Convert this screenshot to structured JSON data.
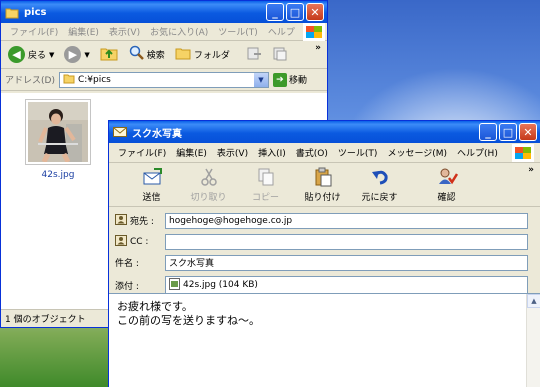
{
  "explorer": {
    "title": "pics",
    "menu": [
      "ファイル(F)",
      "編集(E)",
      "表示(V)",
      "お気に入り(A)",
      "ツール(T)",
      "ヘルプ"
    ],
    "toolbar": {
      "back": "戻る",
      "search": "検索",
      "folders": "フォルダ"
    },
    "address_label": "アドレス(D)",
    "address_value": "C:¥pics",
    "go_label": "移動",
    "file": {
      "name": "42s.jpg"
    },
    "status": "1 個のオブジェクト"
  },
  "mail": {
    "title": "スク水写真",
    "menu": [
      "ファイル(F)",
      "編集(E)",
      "表示(V)",
      "挿入(I)",
      "書式(O)",
      "ツール(T)",
      "メッセージ(M)",
      "ヘルプ(H)"
    ],
    "toolbar": [
      {
        "label": "送信",
        "icon": "send-icon",
        "enabled": true
      },
      {
        "label": "切り取り",
        "icon": "scissors-icon",
        "enabled": false
      },
      {
        "label": "コピー",
        "icon": "copy-icon",
        "enabled": false
      },
      {
        "label": "貼り付け",
        "icon": "paste-icon",
        "enabled": true
      },
      {
        "label": "元に戻す",
        "icon": "undo-icon",
        "enabled": true
      },
      {
        "label": "確認",
        "icon": "check-names-icon",
        "enabled": true
      }
    ],
    "to_label": "宛先 :",
    "to_value": "hogehoge@hogehoge.co.jp",
    "cc_label": "CC :",
    "cc_value": "",
    "subject_label": "件名 :",
    "subject_value": "スク水写真",
    "attach_label": "添付 :",
    "attach_value": "42s.jpg (104 KB)",
    "body_lines": [
      "お疲れ様です。",
      "この前の写を送りますね～。"
    ]
  },
  "colors": {
    "titlebar": "#0a5fe8",
    "close": "#c5391a",
    "chrome": "#ece9d8",
    "desktop_sky": "#3a68c8",
    "desktop_grass": "#3f8a2a"
  }
}
